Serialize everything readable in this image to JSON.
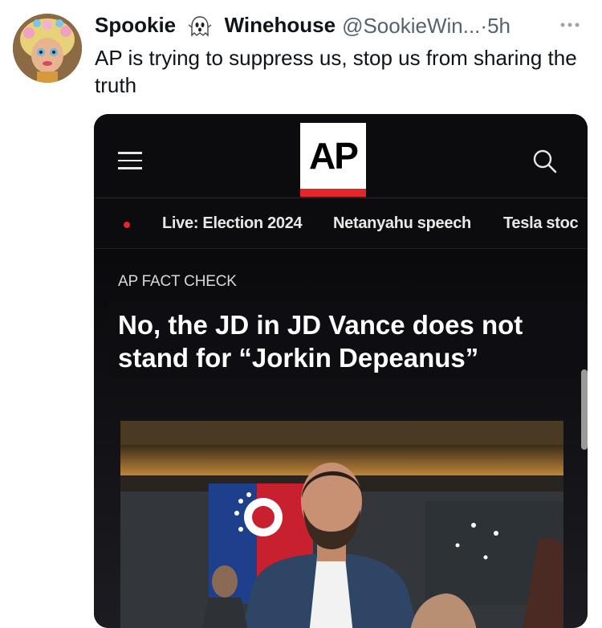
{
  "tweet": {
    "display_name_first": "Spookie",
    "display_name_second": "Winehouse",
    "name_emoji_icon": "ghost-icon",
    "handle": "@SookieWin...",
    "time_separator": "·",
    "time": "5h",
    "more_icon": "more-icon",
    "text": "AP is trying to suppress us, stop us from sharing the truth"
  },
  "embedded": {
    "nav": {
      "menu_icon": "menu-icon",
      "logo_text": "AP",
      "search_icon": "search-icon"
    },
    "topics": [
      "Live: Election 2024",
      "Netanyahu speech",
      "Tesla stoc"
    ],
    "kicker": "AP FACT CHECK",
    "headline": "No, the JD in JD Vance does not stand for “Jorkin Depeanus”"
  },
  "colors": {
    "ap_red": "#e3262a",
    "dark_bg": "#0c0c0e"
  }
}
